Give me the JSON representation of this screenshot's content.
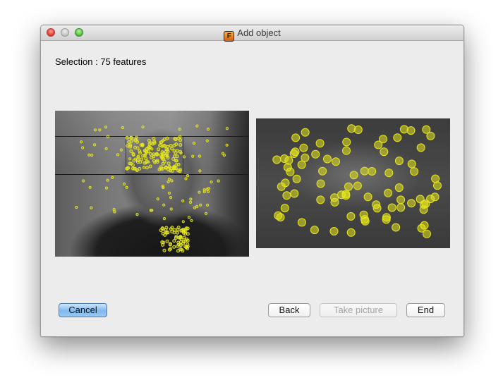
{
  "window": {
    "title": "Add object",
    "app_icon": "F"
  },
  "selection_text": "Selection : 75 features",
  "colors": {
    "feature": "#e6e61e",
    "default_button": "#7db8ef"
  },
  "icons": {
    "app": "app-icon",
    "close": "close-icon",
    "minimize": "minimize-icon",
    "zoom": "zoom-icon"
  },
  "buttons": {
    "cancel": "Cancel",
    "back": "Back",
    "take_picture": "Take picture",
    "end": "End"
  }
}
